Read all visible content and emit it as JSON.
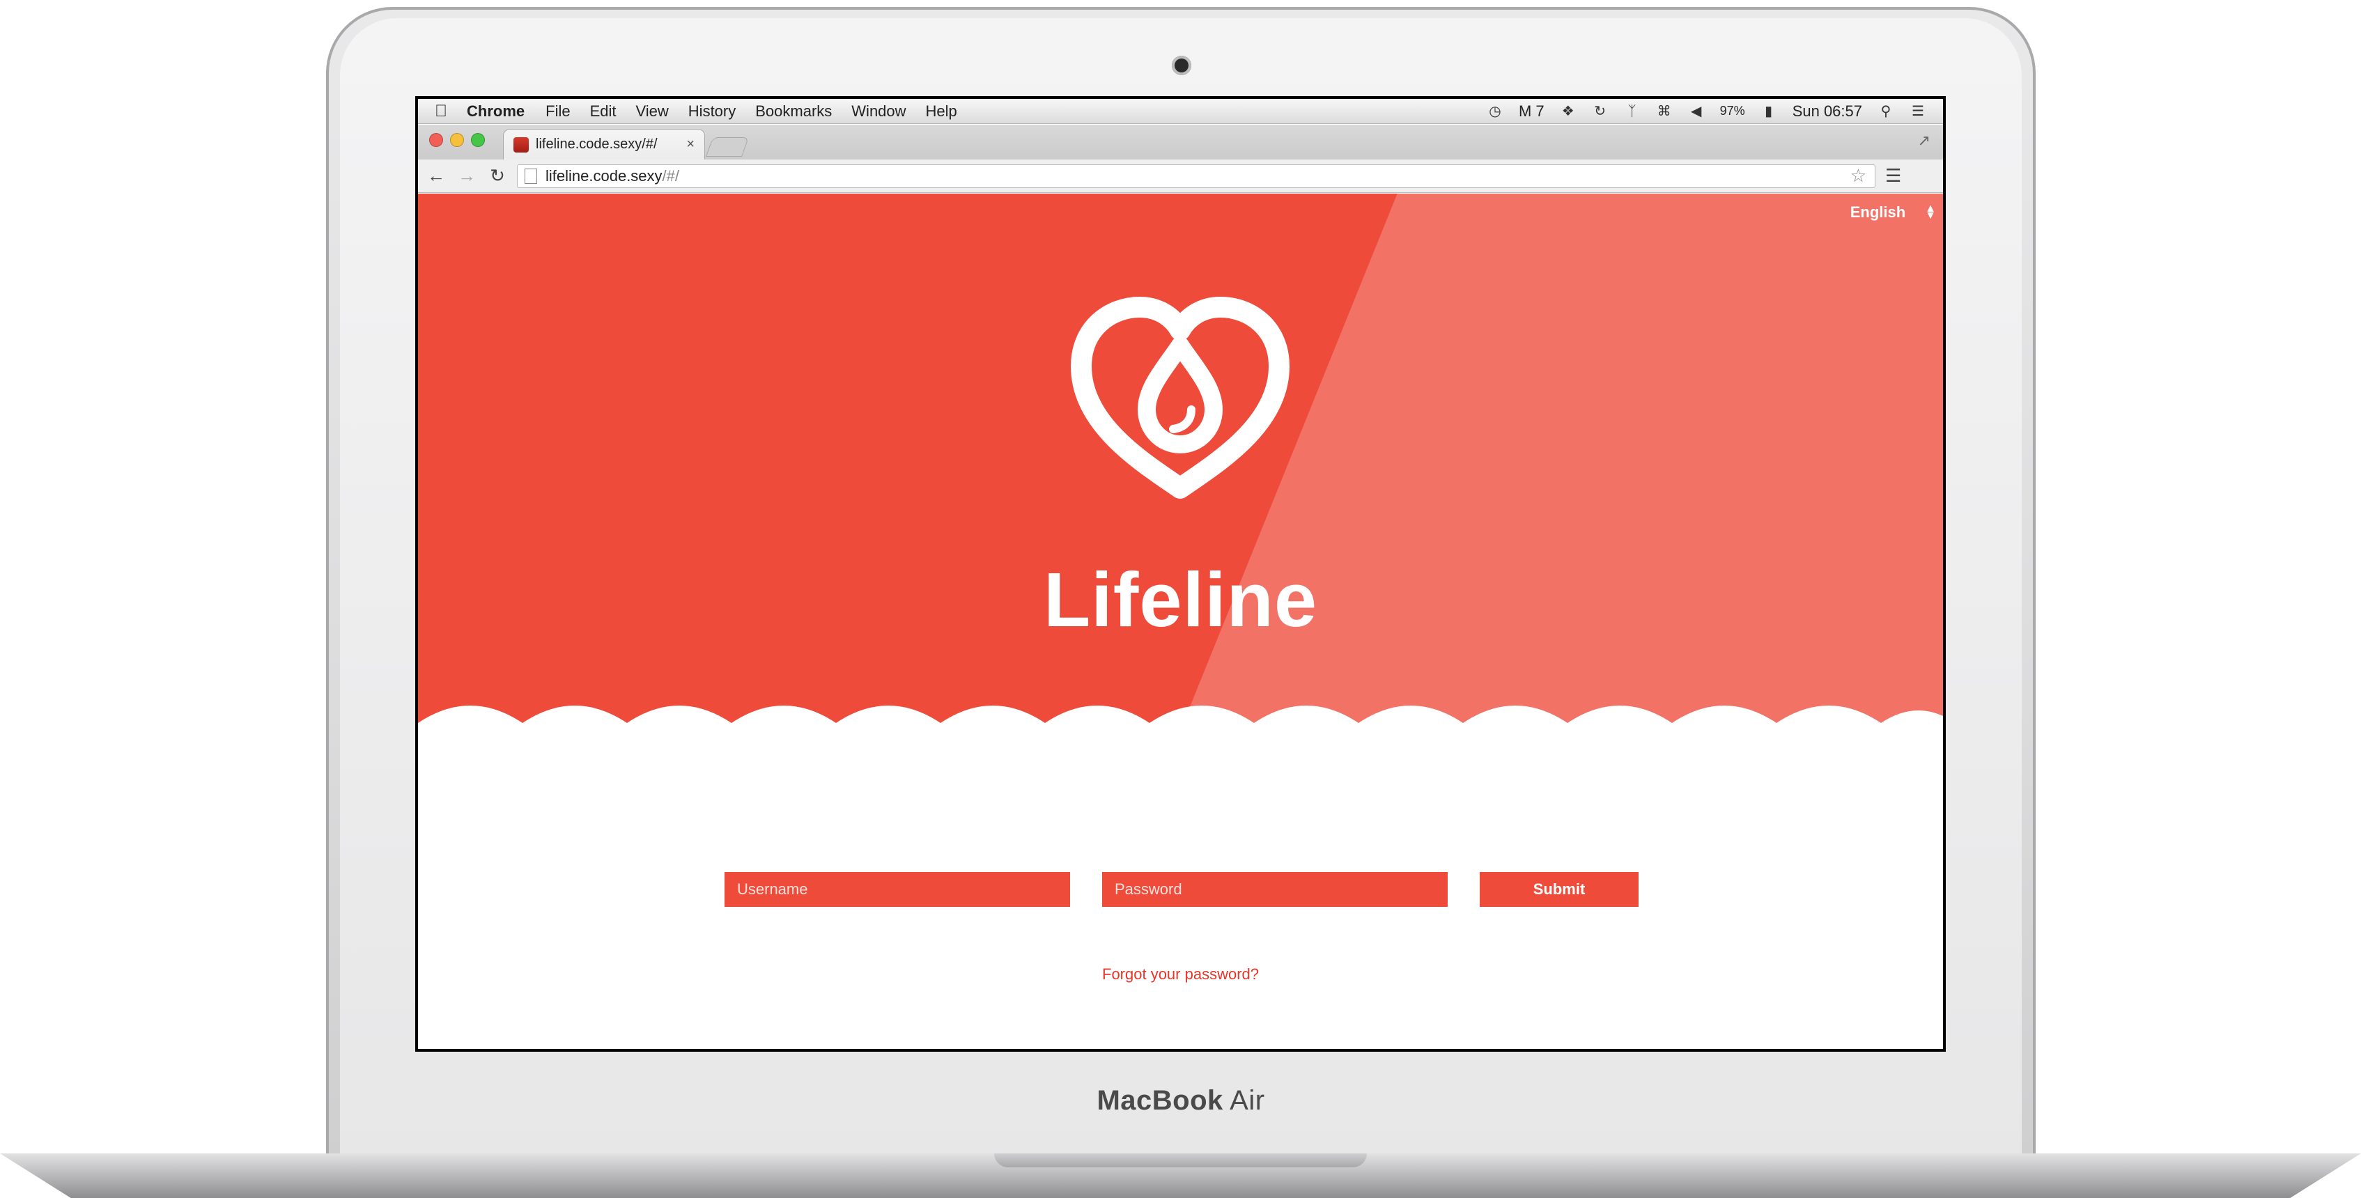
{
  "device": {
    "brand_bold": "MacBook",
    "brand_light": " Air"
  },
  "menubar": {
    "apple": "",
    "app": "Chrome",
    "items": [
      "File",
      "Edit",
      "View",
      "History",
      "Bookmarks",
      "Window",
      "Help"
    ],
    "status": {
      "badge_count": "7",
      "battery": "97%",
      "clock": "Sun 06:57"
    }
  },
  "browser": {
    "tab_title": "lifeline.code.sexy/#/",
    "tab_close": "×",
    "url": "lifeline.code.sexy/#/",
    "url_host": "lifeline.code.sexy",
    "url_path": "/#/"
  },
  "page": {
    "language": "English",
    "title": "Lifeline",
    "username_placeholder": "Username",
    "password_placeholder": "Password",
    "submit_label": "Submit",
    "forgot_link": "Forgot your password?"
  },
  "colors": {
    "brand_red": "#ef4b3a",
    "white": "#ffffff"
  }
}
